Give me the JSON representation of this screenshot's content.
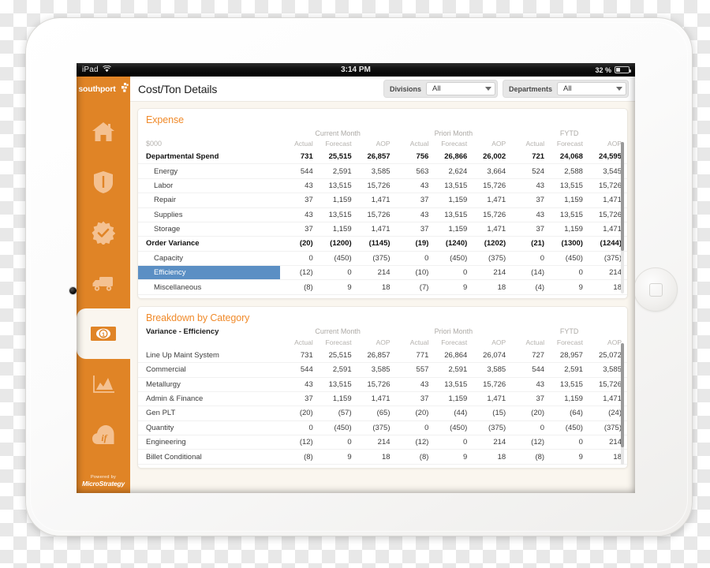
{
  "status_bar": {
    "device": "iPad",
    "wifi_icon": "wifi-icon",
    "clock": "3:14 PM",
    "battery_percent": "32 %"
  },
  "sidebar": {
    "brand": "southport",
    "brand_mark_icon": "southport-squares-icon",
    "items": [
      {
        "id": "home",
        "icon": "home-icon",
        "label": "Home",
        "active": false
      },
      {
        "id": "safety",
        "icon": "shield-icon",
        "label": "Safety",
        "active": false
      },
      {
        "id": "quality",
        "icon": "badge-check-icon",
        "label": "Quality",
        "active": false
      },
      {
        "id": "logistics",
        "icon": "truck-icon",
        "label": "Logistics",
        "active": false
      },
      {
        "id": "cost",
        "icon": "money-bill-icon",
        "label": "Cost",
        "active": true
      },
      {
        "id": "analytics",
        "icon": "area-chart-icon",
        "label": "Analytics",
        "active": false
      },
      {
        "id": "whatif",
        "icon": "if-cloud-icon",
        "label": "What If",
        "active": false
      }
    ],
    "powered_by": "Powered by",
    "powered_brand": "MicroStrategy"
  },
  "header": {
    "title": "Cost/Ton Details",
    "filters": [
      {
        "label": "Divisions",
        "value": "All",
        "caret_icon": "chevron-down-icon"
      },
      {
        "label": "Departments",
        "value": "All",
        "caret_icon": "chevron-down-icon"
      }
    ]
  },
  "expense_card": {
    "title": "Expense",
    "unit_label": "$000",
    "period_groups": [
      "Current Month",
      "Priori Month",
      "FYTD"
    ],
    "measures": [
      "Actual",
      "Forecast",
      "AOP"
    ],
    "rows": [
      {
        "label": "Departmental Spend",
        "bold": true,
        "indent": false,
        "selected": false,
        "values": [
          "731",
          "25,515",
          "26,857",
          "756",
          "26,866",
          "26,002",
          "721",
          "24,068",
          "24,595"
        ]
      },
      {
        "label": "Energy",
        "bold": false,
        "indent": true,
        "selected": false,
        "values": [
          "544",
          "2,591",
          "3,585",
          "563",
          "2,624",
          "3,664",
          "524",
          "2,588",
          "3,545"
        ]
      },
      {
        "label": "Labor",
        "bold": false,
        "indent": true,
        "selected": false,
        "values": [
          "43",
          "13,515",
          "15,726",
          "43",
          "13,515",
          "15,726",
          "43",
          "13,515",
          "15,726"
        ]
      },
      {
        "label": "Repair",
        "bold": false,
        "indent": true,
        "selected": false,
        "values": [
          "37",
          "1,159",
          "1,471",
          "37",
          "1,159",
          "1,471",
          "37",
          "1,159",
          "1,471"
        ]
      },
      {
        "label": "Supplies",
        "bold": false,
        "indent": true,
        "selected": false,
        "values": [
          "43",
          "13,515",
          "15,726",
          "43",
          "13,515",
          "15,726",
          "43",
          "13,515",
          "15,726"
        ]
      },
      {
        "label": "Storage",
        "bold": false,
        "indent": true,
        "selected": false,
        "values": [
          "37",
          "1,159",
          "1,471",
          "37",
          "1,159",
          "1,471",
          "37",
          "1,159",
          "1,471"
        ]
      },
      {
        "label": "Order Variance",
        "bold": true,
        "indent": false,
        "selected": false,
        "values": [
          "(20)",
          "(1200)",
          "(1145)",
          "(19)",
          "(1240)",
          "(1202)",
          "(21)",
          "(1300)",
          "(1244)"
        ]
      },
      {
        "label": "Capacity",
        "bold": false,
        "indent": true,
        "selected": false,
        "values": [
          "0",
          "(450)",
          "(375)",
          "0",
          "(450)",
          "(375)",
          "0",
          "(450)",
          "(375)"
        ]
      },
      {
        "label": "Efficiency",
        "bold": false,
        "indent": true,
        "selected": true,
        "values": [
          "(12)",
          "0",
          "214",
          "(10)",
          "0",
          "214",
          "(14)",
          "0",
          "214"
        ]
      },
      {
        "label": "Miscellaneous",
        "bold": false,
        "indent": true,
        "selected": false,
        "values": [
          "(8)",
          "9",
          "18",
          "(7)",
          "9",
          "18",
          "(4)",
          "9",
          "18"
        ]
      }
    ]
  },
  "breakdown_card": {
    "title": "Breakdown by Category",
    "subtitle": "Variance - Efficiency",
    "period_groups": [
      "Current Month",
      "Priori Month",
      "FYTD"
    ],
    "measures": [
      "Actual",
      "Forecast",
      "AOP"
    ],
    "rows": [
      {
        "label": "Line Up Maint System",
        "values": [
          "731",
          "25,515",
          "26,857",
          "771",
          "26,864",
          "26,074",
          "727",
          "28,957",
          "25,072"
        ]
      },
      {
        "label": "Commercial",
        "values": [
          "544",
          "2,591",
          "3,585",
          "557",
          "2,591",
          "3,585",
          "544",
          "2,591",
          "3,585"
        ]
      },
      {
        "label": "Metallurgy",
        "values": [
          "43",
          "13,515",
          "15,726",
          "43",
          "13,515",
          "15,726",
          "43",
          "13,515",
          "15,726"
        ]
      },
      {
        "label": "Admin & Finance",
        "values": [
          "37",
          "1,159",
          "1,471",
          "37",
          "1,159",
          "1,471",
          "37",
          "1,159",
          "1,471"
        ]
      },
      {
        "label": "Gen PLT",
        "values": [
          "(20)",
          "(57)",
          "(65)",
          "(20)",
          "(44)",
          "(15)",
          "(20)",
          "(64)",
          "(24)"
        ]
      },
      {
        "label": "Quantity",
        "values": [
          "0",
          "(450)",
          "(375)",
          "0",
          "(450)",
          "(375)",
          "0",
          "(450)",
          "(375)"
        ]
      },
      {
        "label": "Engineering",
        "values": [
          "(12)",
          "0",
          "214",
          "(12)",
          "0",
          "214",
          "(12)",
          "0",
          "214"
        ]
      },
      {
        "label": "Billet Conditional",
        "values": [
          "(8)",
          "9",
          "18",
          "(8)",
          "9",
          "18",
          "(8)",
          "9",
          "18"
        ]
      }
    ]
  },
  "colors": {
    "brand_orange": "#e08426",
    "title_orange": "#f08a2a",
    "selection_blue": "#5b8fc4",
    "page_bg": "#faf6ef",
    "card_bg": "#ffffff"
  }
}
